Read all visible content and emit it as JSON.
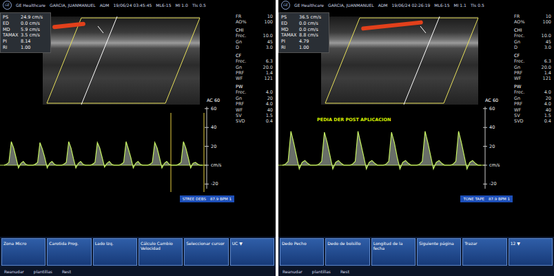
{
  "panels": [
    {
      "header": {
        "logo": "GE",
        "brand": "GE Healthcare",
        "patient": "GARCIA, JUANMANUEL",
        "user": "ADM",
        "date": "19/06/24 03:45:45",
        "probe": "ML6-15",
        "mi": "MI 1.0",
        "tis": "TIs 0.5"
      },
      "measurements": [
        {
          "label": "PS",
          "value": "24.9 cm/s"
        },
        {
          "label": "ED",
          "value": "0.0 cm/s"
        },
        {
          "label": "MD",
          "value": "5.9 cm/s"
        },
        {
          "label": "TAMAX",
          "value": "3.5 cm/s"
        },
        {
          "label": "PI",
          "value": "8.14"
        },
        {
          "label": "RI",
          "value": "1.00"
        }
      ],
      "params": [
        {
          "label": "FR",
          "value": "10"
        },
        {
          "label": "AO%",
          "value": "100"
        },
        {
          "label": "CHI",
          "value": ""
        },
        {
          "label": "Frec.",
          "value": "10.0"
        },
        {
          "label": "Gn",
          "value": "45"
        },
        {
          "label": "D",
          "value": "3.0"
        },
        {
          "label": "CF",
          "value": ""
        },
        {
          "label": "Frec.",
          "value": "6.3"
        },
        {
          "label": "Gn",
          "value": "20.0"
        },
        {
          "label": "PRF",
          "value": "1.4"
        },
        {
          "label": "WF",
          "value": "121"
        },
        {
          "label": "PW",
          "value": ""
        },
        {
          "label": "Frec.",
          "value": "4.0"
        },
        {
          "label": "Gn",
          "value": "20"
        },
        {
          "label": "PRF",
          "value": "4.0"
        },
        {
          "label": "WF",
          "value": "40"
        },
        {
          "label": "SV",
          "value": "1.5"
        },
        {
          "label": "SVD",
          "value": "0.4"
        }
      ],
      "scale": {
        "label": "AC 60",
        "ticks": [
          "60",
          "40",
          "20",
          "cm/s",
          "-20"
        ]
      },
      "trace": [
        0,
        1,
        3,
        25,
        18,
        8,
        -3,
        2,
        4,
        1,
        0,
        0,
        0,
        1,
        3,
        24,
        17,
        8,
        -3,
        2,
        4,
        1,
        0,
        0,
        0,
        1,
        3,
        25,
        18,
        7,
        -3,
        2,
        4,
        1,
        0,
        0,
        0,
        1,
        3,
        24,
        18,
        8,
        -2,
        2,
        4,
        1,
        0,
        0,
        0,
        1,
        3,
        25,
        17,
        8,
        -3,
        2,
        4,
        1,
        0,
        0,
        0,
        1,
        3,
        24,
        18,
        8,
        -3,
        2,
        4,
        1,
        0,
        0,
        0,
        1,
        3,
        25,
        18,
        8,
        -3,
        2,
        3,
        1,
        0,
        0
      ],
      "status": [
        "STREE DEBS",
        "87.9 BPM 1"
      ],
      "buttons": [
        "Zona Micro",
        "Carotida Prog.",
        "Lado Izq.",
        "Cálculo Cambio Velocidad",
        "Seleccionar cursor",
        "UC ▼"
      ],
      "footer": [
        "Reanudar",
        "plantillas",
        "Rest"
      ]
    },
    {
      "header": {
        "logo": "GE",
        "brand": "GE Healthcare",
        "patient": "GARCIA, JUANMANUEL",
        "user": "ADM",
        "date": "19/06/24 02:26:19",
        "probe": "ML6-15",
        "mi": "MI 1.1",
        "tis": "TIs 0.5"
      },
      "measurements": [
        {
          "label": "PS",
          "value": "36.5 cm/s"
        },
        {
          "label": "ED",
          "value": "0.0 cm/s"
        },
        {
          "label": "MD",
          "value": "0.0 cm/s"
        },
        {
          "label": "TAMAX",
          "value": "8.8 cm/s"
        },
        {
          "label": "PI",
          "value": "4.79"
        },
        {
          "label": "RI",
          "value": "1.00"
        }
      ],
      "params": [
        {
          "label": "FR",
          "value": "10"
        },
        {
          "label": "AO%",
          "value": "100"
        },
        {
          "label": "CHI",
          "value": ""
        },
        {
          "label": "Frec.",
          "value": "10.0"
        },
        {
          "label": "Gn",
          "value": "45"
        },
        {
          "label": "D",
          "value": "3.0"
        },
        {
          "label": "CF",
          "value": ""
        },
        {
          "label": "Frec.",
          "value": "6.3"
        },
        {
          "label": "Gn",
          "value": "20.0"
        },
        {
          "label": "PRF",
          "value": "1.4"
        },
        {
          "label": "WF",
          "value": "121"
        },
        {
          "label": "PW",
          "value": ""
        },
        {
          "label": "Frec.",
          "value": "4.0"
        },
        {
          "label": "Gn",
          "value": "20"
        },
        {
          "label": "PRF",
          "value": "4.0"
        },
        {
          "label": "WF",
          "value": "40"
        },
        {
          "label": "SV",
          "value": "1.5"
        },
        {
          "label": "SVD",
          "value": "0.4"
        }
      ],
      "scale": {
        "label": "AC 60",
        "ticks": [
          "60",
          "40",
          "20",
          "cm/s",
          "-20"
        ]
      },
      "annotation": "PEDIA DER POST APLICACION",
      "trace": [
        0,
        1,
        4,
        36,
        24,
        10,
        -4,
        3,
        5,
        2,
        0,
        0,
        0,
        1,
        4,
        35,
        24,
        10,
        -4,
        3,
        5,
        2,
        0,
        0,
        0,
        1,
        4,
        36,
        23,
        10,
        -4,
        3,
        5,
        2,
        0,
        0,
        0,
        1,
        4,
        35,
        24,
        9,
        -4,
        3,
        5,
        2,
        0,
        0,
        0,
        1,
        4,
        36,
        24,
        10,
        -4,
        3,
        5,
        2,
        0,
        0,
        0,
        1,
        4,
        36,
        24,
        10,
        -4,
        3,
        5,
        2,
        0,
        0
      ],
      "status": [
        "TONE TAPE",
        "87.9 BPM 1"
      ],
      "buttons": [
        "Dedo Pecho",
        "Dedo de bolsillo",
        "Longitud de la fecha",
        "Siguiente página",
        "Trazar",
        "12 ▼"
      ],
      "footer": [
        "Reanudar",
        "plantillas",
        "Rest"
      ]
    }
  ]
}
